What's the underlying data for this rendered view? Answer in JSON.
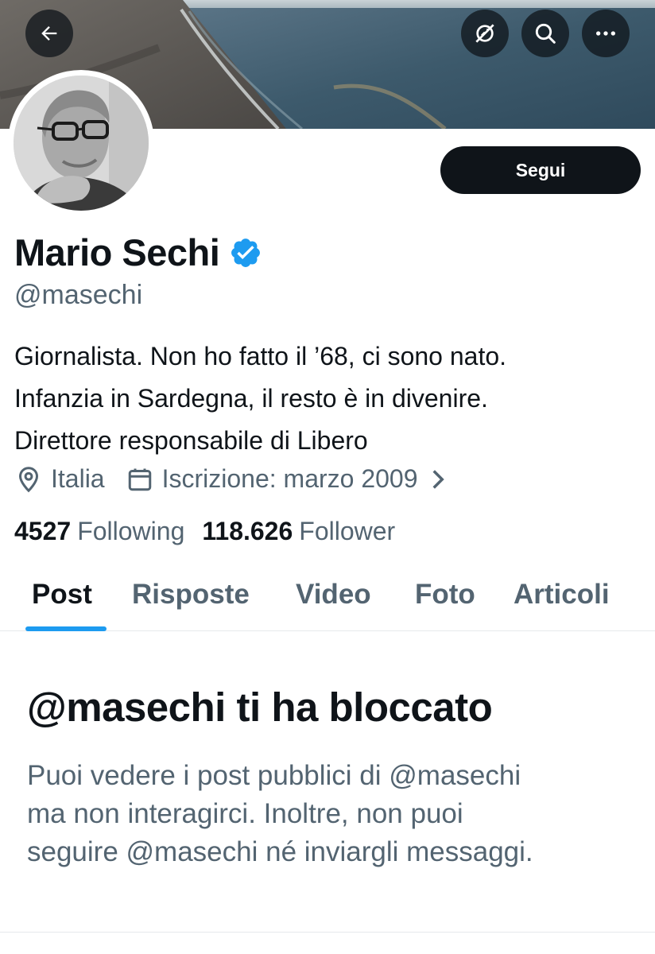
{
  "profile": {
    "name": "Mario Sechi",
    "handle": "@masechi",
    "bio_lines": [
      "Giornalista. Non ho fatto il ’68, ci sono nato.",
      "Infanzia in Sardegna, il resto è in divenire.",
      "Direttore responsabile di Libero"
    ],
    "location": "Italia",
    "joined": "Iscrizione: marzo 2009",
    "following_count": "4527",
    "following_label": "Following",
    "followers_count": "118.626",
    "followers_label": "Follower",
    "follow_button": "Segui",
    "verified_color": "#1d9bf0"
  },
  "tabs": [
    "Post",
    "Risposte",
    "Video",
    "Foto",
    "Articoli"
  ],
  "active_tab": "Post",
  "blocked": {
    "title": "@masechi ti ha bloccato",
    "lines": [
      "Puoi vedere i post pubblici di @masechi",
      "ma non interagirci. Inoltre, non puoi",
      "seguire @masechi né inviargli messaggi."
    ]
  },
  "icons": [
    "back-arrow-icon",
    "link-off-icon",
    "search-icon",
    "more-icon",
    "verified-badge-icon",
    "location-icon",
    "calendar-icon",
    "chevron-right-icon"
  ]
}
